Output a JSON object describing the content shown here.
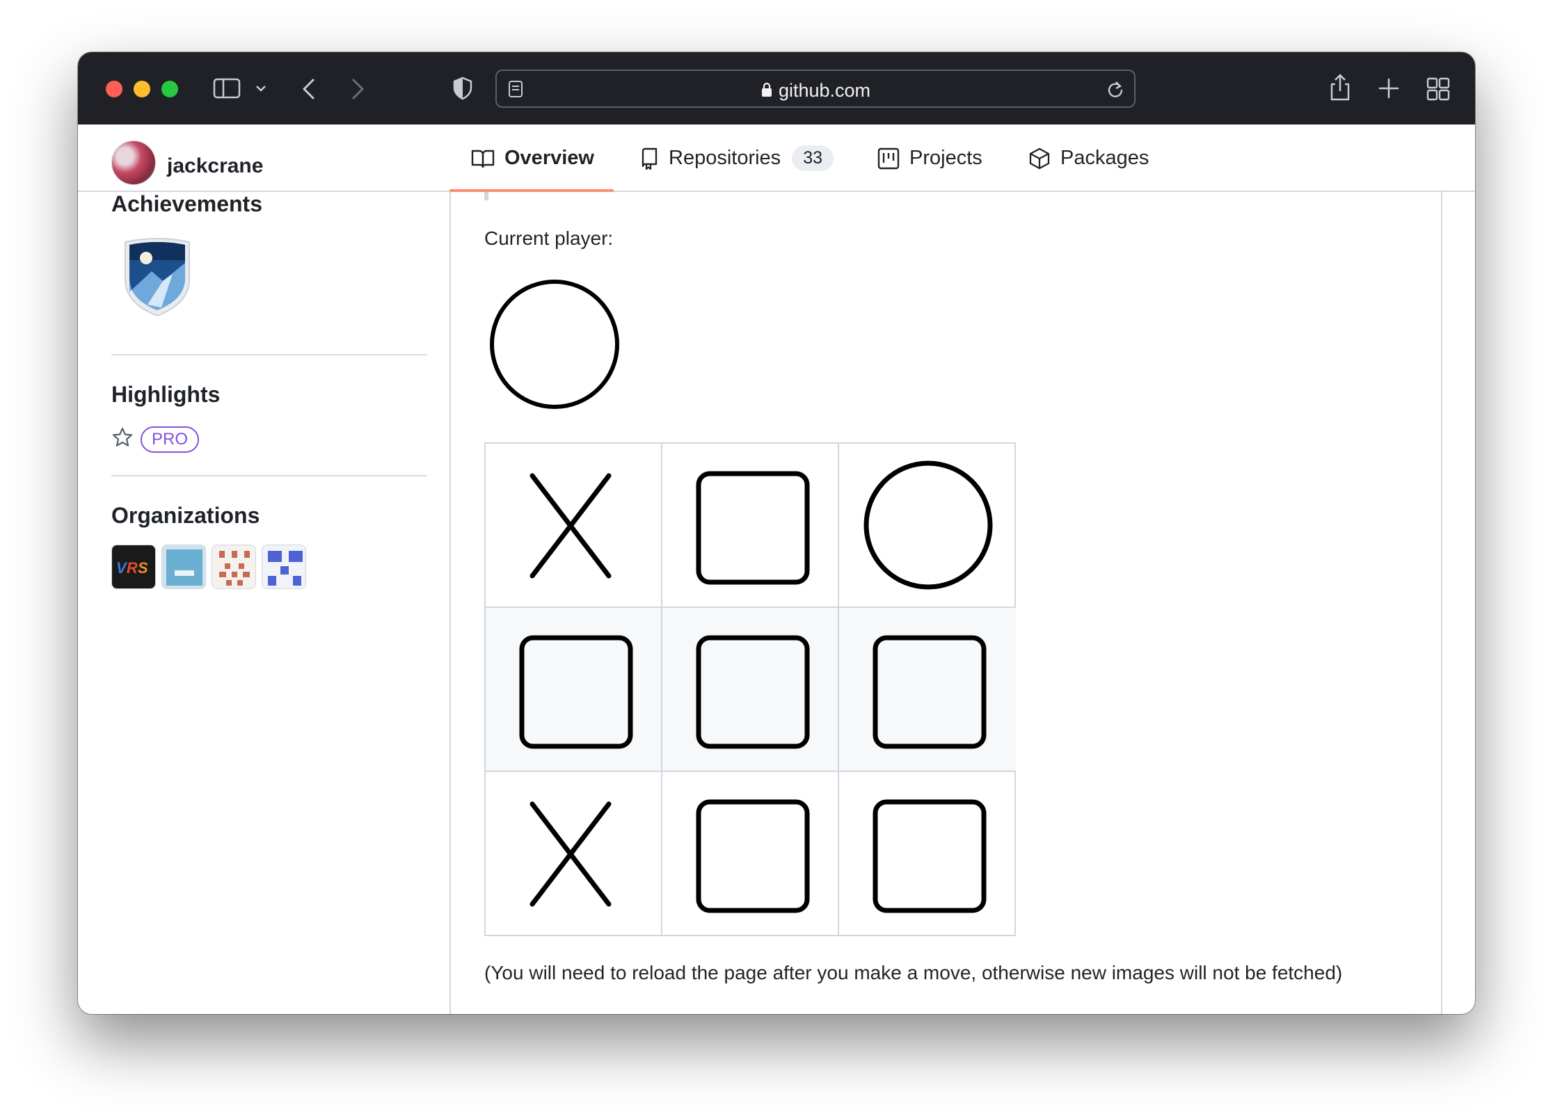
{
  "browser": {
    "url": "github.com"
  },
  "profile": {
    "username": "jackcrane"
  },
  "tabs": [
    {
      "label": "Overview",
      "icon": "book-icon",
      "selected": true
    },
    {
      "label": "Repositories",
      "icon": "repo-icon",
      "count": "33"
    },
    {
      "label": "Projects",
      "icon": "project-icon"
    },
    {
      "label": "Packages",
      "icon": "package-icon"
    }
  ],
  "sidebar": {
    "achievements_title": "Achievements",
    "highlights_title": "Highlights",
    "pro_label": "PRO",
    "organizations_title": "Organizations",
    "orgs": [
      {
        "icon": "vrs-logo-icon"
      },
      {
        "icon": "blue-org-icon"
      },
      {
        "icon": "red-pixel-org-icon"
      },
      {
        "icon": "blue-pixel-org-icon"
      }
    ]
  },
  "game": {
    "current_player_label": "Current player:",
    "current_player": "O",
    "board": [
      [
        "X",
        "",
        "O"
      ],
      [
        "",
        "",
        ""
      ],
      [
        "X",
        "",
        ""
      ]
    ],
    "note": "(You will need to reload the page after you make a move, otherwise new images will not be fetched)"
  },
  "colors": {
    "toolbar": "#1f2126",
    "accent_underline": "#fd8c73",
    "pro_purple": "#8250df"
  }
}
